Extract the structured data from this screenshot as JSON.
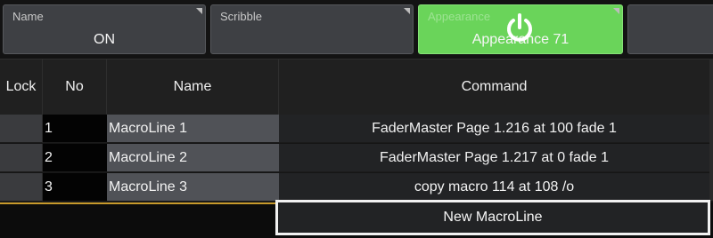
{
  "properties": [
    {
      "caption": "Name",
      "value": "ON"
    },
    {
      "caption": "Scribble",
      "value": ""
    },
    {
      "caption": "Appearance",
      "value": "Appearance 71"
    },
    {
      "caption": "",
      "value": ""
    }
  ],
  "table": {
    "headers": [
      "Lock",
      "No",
      "Name",
      "Command"
    ],
    "rows": [
      {
        "lock": "",
        "no": "1",
        "name": "MacroLine 1",
        "command": "FaderMaster Page 1.216 at 100 fade 1"
      },
      {
        "lock": "",
        "no": "2",
        "name": "MacroLine 2",
        "command": "FaderMaster Page 1.217 at 0 fade 1"
      },
      {
        "lock": "",
        "no": "3",
        "name": "MacroLine 3",
        "command": "copy macro 114 at 108 /o"
      }
    ]
  },
  "new_line_label": "New MacroLine",
  "colors": {
    "appearance_accent": "#6ad45a",
    "selection_outline": "#f2f2f2",
    "edit_line": "#c89a2c"
  },
  "icons": {
    "appearance": "power-icon"
  }
}
